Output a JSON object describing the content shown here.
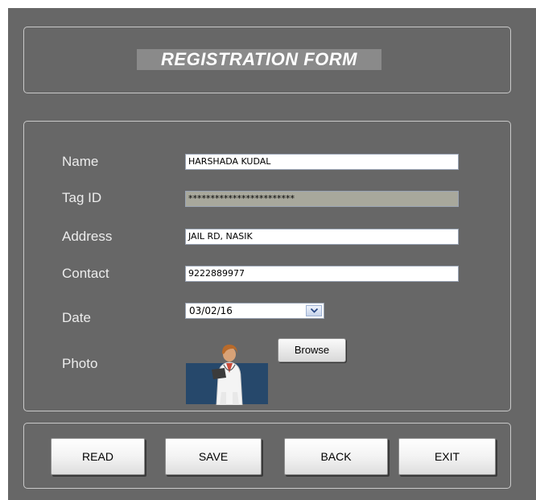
{
  "form": {
    "title": "REGISTRATION FORM",
    "name_label": "Name",
    "name_value": "HARSHADA KUDAL",
    "tag_label": "Tag ID",
    "tag_value": "************************",
    "address_label": "Address",
    "address_value": "JAIL RD, NASIK",
    "contact_label": "Contact",
    "contact_value": "9222889977",
    "date_label": "Date",
    "date_value": "03/02/16",
    "photo_label": "Photo",
    "browse_label": "Browse"
  },
  "buttons": {
    "read": "READ",
    "save": "SAVE",
    "back": "BACK",
    "exit": "EXIT"
  },
  "colors": {
    "background": "#676767",
    "readonly_field": "#a8a89c",
    "photo_background": "#26486b"
  },
  "icons": {
    "dropdown": "chevron-down-icon",
    "photo": "doctor-avatar"
  }
}
